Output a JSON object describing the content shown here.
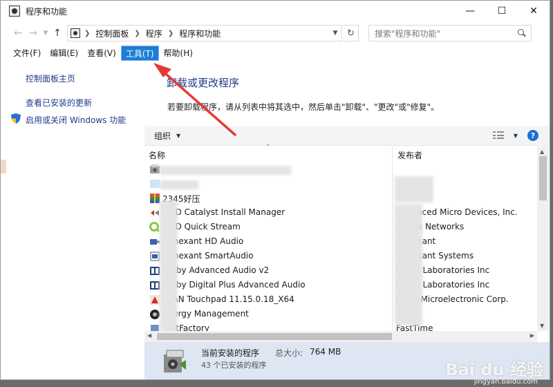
{
  "window": {
    "title": "程序和功能"
  },
  "address": {
    "crumbs": [
      "控制面板",
      "程序",
      "程序和功能"
    ],
    "search_placeholder": "搜索\"程序和功能\""
  },
  "menu": {
    "items": [
      "文件(F)",
      "编辑(E)",
      "查看(V)",
      "工具(T)",
      "帮助(H)"
    ],
    "active_index": 3
  },
  "left_pane": {
    "links": [
      "控制面板主页",
      "查看已安装的更新",
      "启用或关闭 Windows 功能"
    ]
  },
  "main": {
    "title": "卸载或更改程序",
    "description": "若要卸载程序，请从列表中将其选中，然后单击\"卸载\"、\"更改\"或\"修复\"。",
    "organize_label": "组织",
    "help_label": "?"
  },
  "list": {
    "columns": [
      "名称",
      "发布者"
    ],
    "rows": [
      {
        "name": "",
        "publisher": "",
        "icon": "installer-icon"
      },
      {
        "name": "",
        "publisher": "",
        "icon": "blank-icon"
      },
      {
        "name": "2345好压",
        "publisher": "",
        "icon": "archive-icon"
      },
      {
        "name": "AMD Catalyst Install Manager",
        "publisher": "Advanced Micro Devices, Inc.",
        "icon": "amd-icon"
      },
      {
        "name": "AMD Quick Stream",
        "publisher": "AppEx Networks",
        "icon": "quickstream-icon"
      },
      {
        "name": "Conexant HD Audio",
        "publisher": "Conexant",
        "icon": "audio-driver-icon"
      },
      {
        "name": "Conexant SmartAudio",
        "publisher": "Conexant Systems",
        "icon": "smartaudio-icon"
      },
      {
        "name": "Dolby Advanced Audio v2",
        "publisher": "Dolby Laboratories Inc",
        "icon": "dolby-icon"
      },
      {
        "name": "Dolby Digital Plus Advanced Audio",
        "publisher": "Dolby Laboratories Inc",
        "icon": "dolby-icon"
      },
      {
        "name": "ELAN Touchpad 11.15.0.18_X64",
        "publisher": "ELAN Microelectronic Corp.",
        "icon": "touchpad-icon"
      },
      {
        "name": "Energy Management",
        "publisher": "",
        "icon": "energy-icon"
      },
      {
        "name": "FastFactory",
        "publisher": "FastTime",
        "icon": "generic-icon"
      }
    ]
  },
  "status": {
    "title": "当前安装的程序",
    "size_label": "总大小:",
    "size_value": "764 MB",
    "count_text": "43 个已安装的程序"
  },
  "watermark": {
    "text": "Bai du 经验",
    "sub": "jingyan.baidu.com"
  },
  "colors": {
    "menu_active": "#1c7ed6",
    "link": "#1f3a8a",
    "status_bg": "#dde6f2",
    "annotation_arrow": "#e53935"
  }
}
